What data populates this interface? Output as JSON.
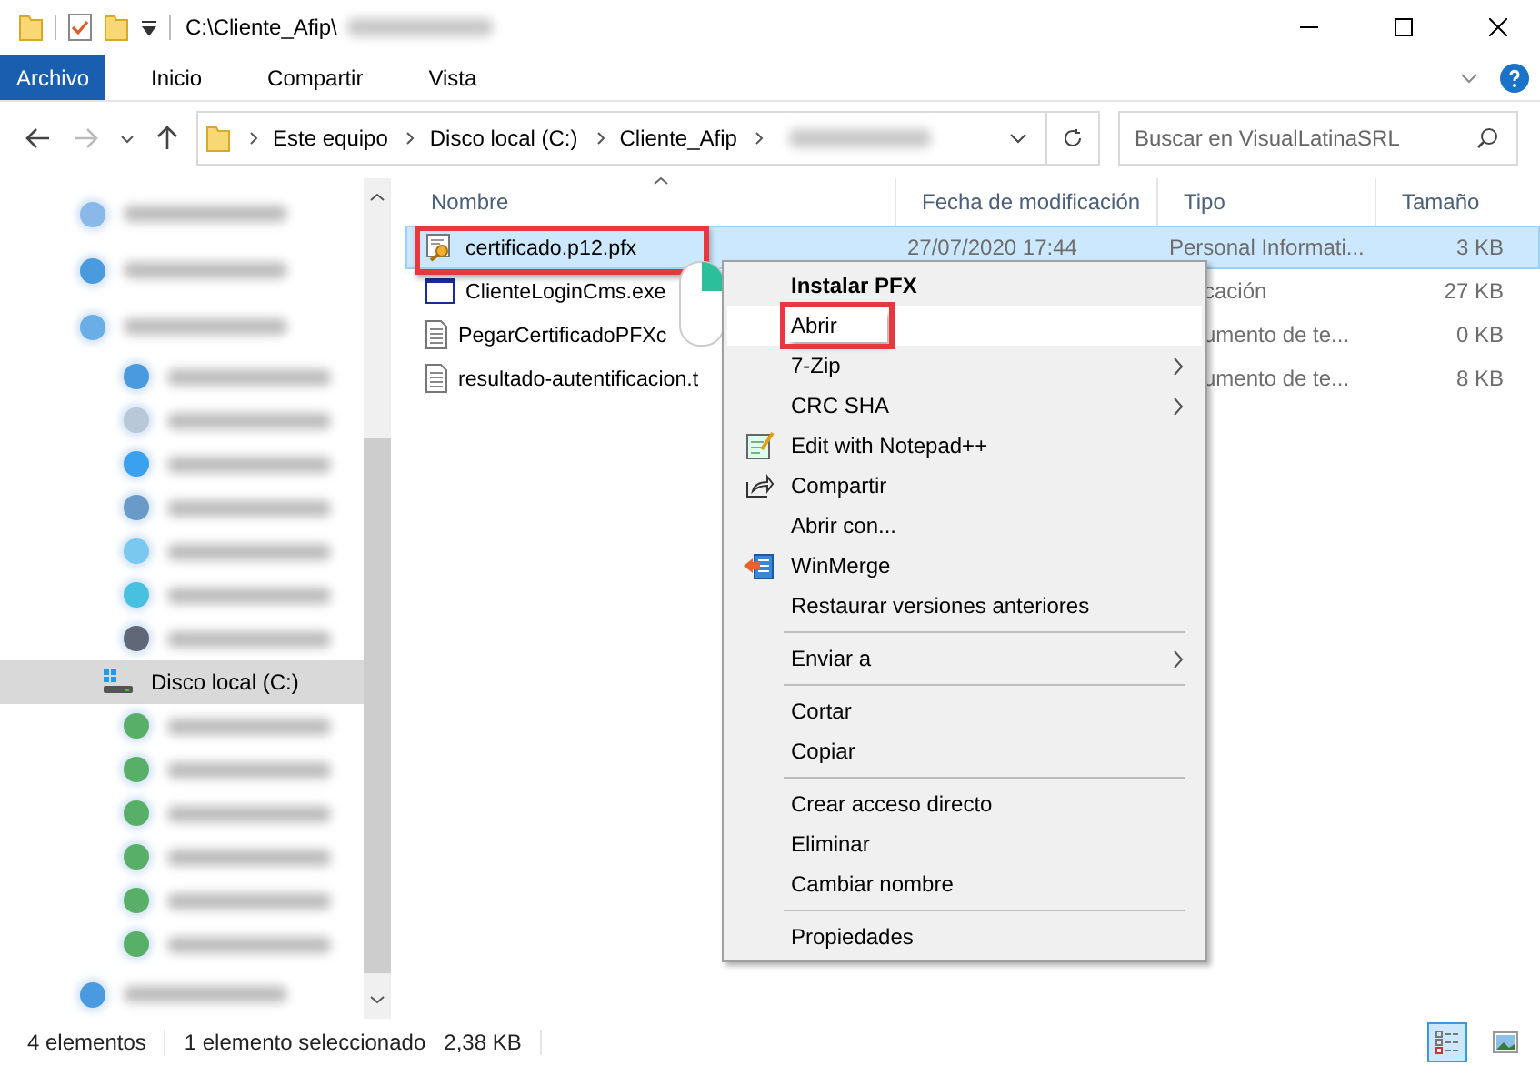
{
  "window": {
    "title": "C:\\Cliente_Afip\\"
  },
  "ribbon_tabs": [
    {
      "label": "Archivo",
      "selected": true
    },
    {
      "label": "Inicio",
      "selected": false
    },
    {
      "label": "Compartir",
      "selected": false
    },
    {
      "label": "Vista",
      "selected": false
    }
  ],
  "address": {
    "segments": [
      "Este equipo",
      "Disco local (C:)",
      "Cliente_Afip"
    ],
    "search_placeholder": "Buscar en VisualLatinaSRL"
  },
  "nav": [
    {
      "kind": "blurred",
      "color": "#8ab8e8"
    },
    {
      "kind": "blurred",
      "color": "#4a9ae0"
    },
    {
      "kind": "blurred",
      "color": "#6aaee8",
      "children": [
        {
          "kind": "blurred",
          "color": "#4a9ae0"
        },
        {
          "kind": "blurred",
          "color": "#b8c8d8"
        },
        {
          "kind": "blurred",
          "color": "#3aa0f0"
        },
        {
          "kind": "blurred",
          "color": "#6a9ac8"
        },
        {
          "kind": "blurred",
          "color": "#7ac8f0"
        },
        {
          "kind": "blurred",
          "color": "#48c0e0"
        },
        {
          "kind": "blurred",
          "color": "#606878"
        },
        {
          "kind": "drive",
          "label": "Disco local (C:)",
          "selected": true
        },
        {
          "kind": "blurred",
          "color": "#58b068"
        },
        {
          "kind": "blurred",
          "color": "#58b068"
        },
        {
          "kind": "blurred",
          "color": "#58b068"
        },
        {
          "kind": "blurred",
          "color": "#58b068"
        },
        {
          "kind": "blurred",
          "color": "#58b068"
        },
        {
          "kind": "blurred",
          "color": "#58b068"
        }
      ]
    },
    {
      "kind": "blurred",
      "color": "#4a9ae0"
    }
  ],
  "columns": [
    "Nombre",
    "Fecha de modificación",
    "Tipo",
    "Tamaño"
  ],
  "files": [
    {
      "kind": "certificate",
      "name": "certificado.p12.pfx",
      "date": "27/07/2020 17:44",
      "type": "Personal Informati...",
      "type_covered": false,
      "size": "3 KB",
      "selected": true,
      "highlight": true
    },
    {
      "kind": "program",
      "name": "ClienteLoginCms.exe",
      "type": "cación",
      "type_covered": true,
      "size": "27 KB",
      "selected": false,
      "highlight": false
    },
    {
      "kind": "text",
      "name": "PegarCertificadoPFXc",
      "type": "umento de te...",
      "type_covered": true,
      "size": "0 KB",
      "selected": false,
      "highlight": false
    },
    {
      "kind": "text",
      "name": "resultado-autentificacion.t",
      "type": "umento de te...",
      "type_covered": true,
      "size": "8 KB",
      "selected": false,
      "highlight": false
    }
  ],
  "context_menu": [
    {
      "kind": "plain",
      "label": "Instalar PFX",
      "default": true,
      "hovered": false,
      "highlight": false,
      "submenu": false
    },
    {
      "kind": "plain",
      "label": "Abrir",
      "default": false,
      "hovered": true,
      "highlight": true,
      "submenu": false
    },
    {
      "kind": "plain",
      "label": "7-Zip",
      "default": false,
      "hovered": false,
      "highlight": false,
      "submenu": true
    },
    {
      "kind": "plain",
      "label": "CRC SHA",
      "default": false,
      "hovered": false,
      "highlight": false,
      "submenu": true
    },
    {
      "kind": "notepad",
      "label": "Edit with Notepad++",
      "default": false,
      "hovered": false,
      "highlight": false,
      "submenu": false
    },
    {
      "kind": "share",
      "label": "Compartir",
      "default": false,
      "hovered": false,
      "highlight": false,
      "submenu": false
    },
    {
      "kind": "plain",
      "label": "Abrir con...",
      "default": false,
      "hovered": false,
      "highlight": false,
      "submenu": false
    },
    {
      "kind": "winmerge",
      "label": "WinMerge",
      "default": false,
      "hovered": false,
      "highlight": false,
      "submenu": false
    },
    {
      "kind": "plain",
      "label": "Restaurar versiones anteriores",
      "default": false,
      "hovered": false,
      "highlight": false,
      "submenu": false
    },
    {
      "kind": "separator"
    },
    {
      "kind": "plain",
      "label": "Enviar a",
      "default": false,
      "hovered": false,
      "highlight": false,
      "submenu": true
    },
    {
      "kind": "separator"
    },
    {
      "kind": "plain",
      "label": "Cortar",
      "default": false,
      "hovered": false,
      "highlight": false,
      "submenu": false
    },
    {
      "kind": "plain",
      "label": "Copiar",
      "default": false,
      "hovered": false,
      "highlight": false,
      "submenu": false
    },
    {
      "kind": "separator"
    },
    {
      "kind": "plain",
      "label": "Crear acceso directo",
      "default": false,
      "hovered": false,
      "highlight": false,
      "submenu": false
    },
    {
      "kind": "plain",
      "label": "Eliminar",
      "default": false,
      "hovered": false,
      "highlight": false,
      "submenu": false
    },
    {
      "kind": "plain",
      "label": "Cambiar nombre",
      "default": false,
      "hovered": false,
      "highlight": false,
      "submenu": false
    },
    {
      "kind": "separator"
    },
    {
      "kind": "plain",
      "label": "Propiedades",
      "default": false,
      "hovered": false,
      "highlight": false,
      "submenu": false
    }
  ],
  "status_bar": {
    "count": "4 elementos",
    "selection": "1 elemento seleccionado",
    "size": "2,38 KB",
    "views": [
      {
        "kind": "details",
        "selected": true
      },
      {
        "kind": "large-icons",
        "selected": false
      }
    ]
  }
}
